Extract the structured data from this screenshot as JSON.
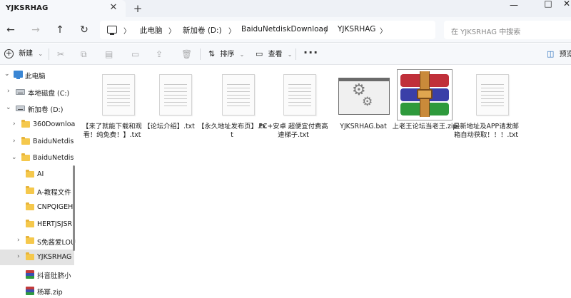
{
  "window": {
    "tab_title": "YJKSRHAG",
    "tab_close_icon": "close-icon",
    "new_tab_icon": "plus-icon",
    "controls": [
      "minimize-icon",
      "maximize-icon",
      "close-icon"
    ]
  },
  "address": {
    "breadcrumb": [
      "此电脑",
      "新加卷 (D:)",
      "BaiduNetdiskDownload",
      "YJKSRHAG"
    ],
    "search_placeholder": "在 YJKSRHAG 中搜索"
  },
  "toolbar": {
    "new_label": "新建",
    "sort_label": "排序",
    "view_label": "查看",
    "more_label": "···",
    "preview_label": "预览"
  },
  "sidebar": {
    "items": [
      {
        "label": "此电脑"
      },
      {
        "label": "本地磁盘 (C:)"
      },
      {
        "label": "新加卷 (D:)"
      },
      {
        "label": "360Downloa"
      },
      {
        "label": "BaiduNetdis"
      },
      {
        "label": "BaiduNetdis"
      },
      {
        "label": "AI"
      },
      {
        "label": "A-教程文件"
      },
      {
        "label": "CNPQIGEH"
      },
      {
        "label": "HERTJSJSR"
      },
      {
        "label": "S免酱爱LOU"
      },
      {
        "label": "YJKSRHAG"
      },
      {
        "label": "抖音肚脐小"
      },
      {
        "label": "杨幂.zip"
      }
    ]
  },
  "files": [
    {
      "name": "【来了就能下载和观看！纯免费！】.txt",
      "type": "txt"
    },
    {
      "name": "【论坛介绍】.txt",
      "type": "txt"
    },
    {
      "name": "【永久地址发布页】.txt",
      "type": "txt"
    },
    {
      "name": "PC+安卓 超便宜付费高速梯子.txt",
      "type": "txt"
    },
    {
      "name": "YJKSRHAG.bat",
      "type": "bat"
    },
    {
      "name": "上老王论坛当老王.zip",
      "type": "zip"
    },
    {
      "name": "最新地址及APP请发邮箱自动获取！！！.txt",
      "type": "txt"
    }
  ]
}
